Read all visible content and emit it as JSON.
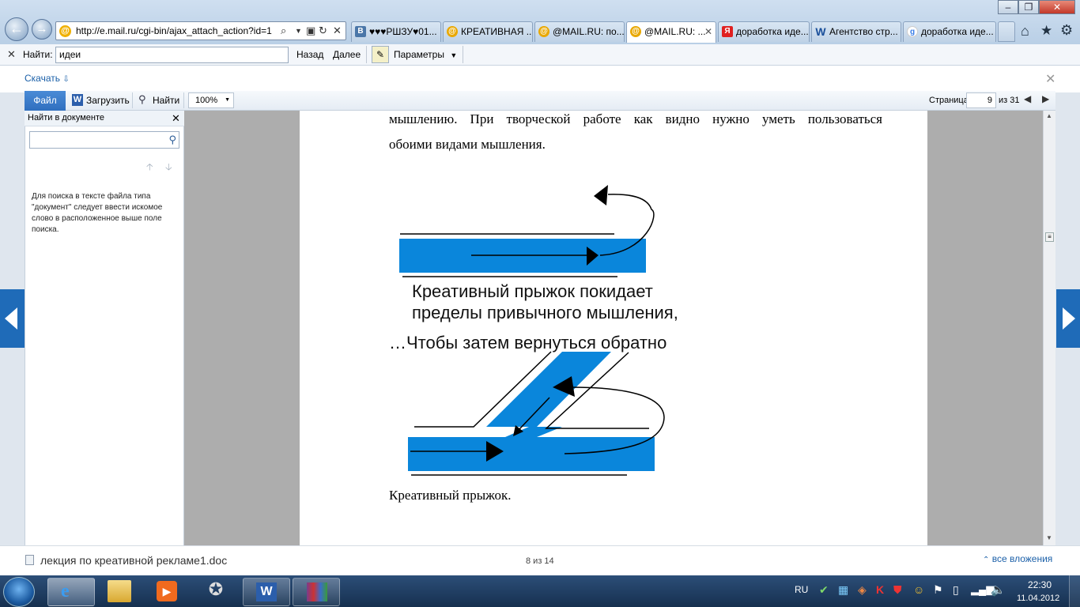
{
  "browser": {
    "url": "http://e.mail.ru/cgi-bin/ajax_attach_action?id=1",
    "tabs": [
      {
        "label": "♥♥♥РШЗУ♥01...",
        "icon": "vk-icon"
      },
      {
        "label": "КРЕАТИВНАЯ ...",
        "icon": "mail-at-icon"
      },
      {
        "label": "@MAIL.RU: по...",
        "icon": "mail-at-icon"
      },
      {
        "label": "@MAIL.RU: ...",
        "icon": "mail-at-icon"
      },
      {
        "label": "доработка иде...",
        "icon": "yandex-icon"
      },
      {
        "label": "Агентство стр...",
        "icon": "wiki-icon"
      },
      {
        "label": "доработка иде...",
        "icon": "google-icon"
      }
    ]
  },
  "findbar": {
    "label": "Найти:",
    "value": "идеи",
    "prev": "Назад",
    "next": "Далее",
    "options": "Параметры"
  },
  "viewer": {
    "download": "Скачать",
    "file_btn": "Файл",
    "upload_btn": "Загрузить",
    "find_btn": "Найти",
    "zoom": "100%",
    "page_label": "Страница",
    "page_num": "9",
    "page_total": "из 31"
  },
  "sidepanel": {
    "title": "Найти в документе",
    "help": "Для поиска в тексте файла типа \"документ\" следует ввести искомое слово в расположенное выше поле поиска."
  },
  "document": {
    "para_line1": "мышлению. При творческой работе как видно нужно уметь пользоваться",
    "para_line2": "обоими видами мышления.",
    "diagram_text1": "Креативный прыжок покидает",
    "diagram_text2": "пределы привычного мышления,",
    "diagram_text3": "…Чтобы затем вернуться обратно",
    "caption": "Креативный прыжок."
  },
  "bottombar": {
    "filename": "лекция по креативной рекламе1.doc",
    "counter": "8 из 14",
    "all_attachments": "все вложения"
  },
  "taskbar": {
    "lang": "RU",
    "time": "22:30",
    "date": "11.04.2012"
  },
  "colors": {
    "diagram_blue": "#0a86db",
    "accent": "#1f6bb8"
  }
}
